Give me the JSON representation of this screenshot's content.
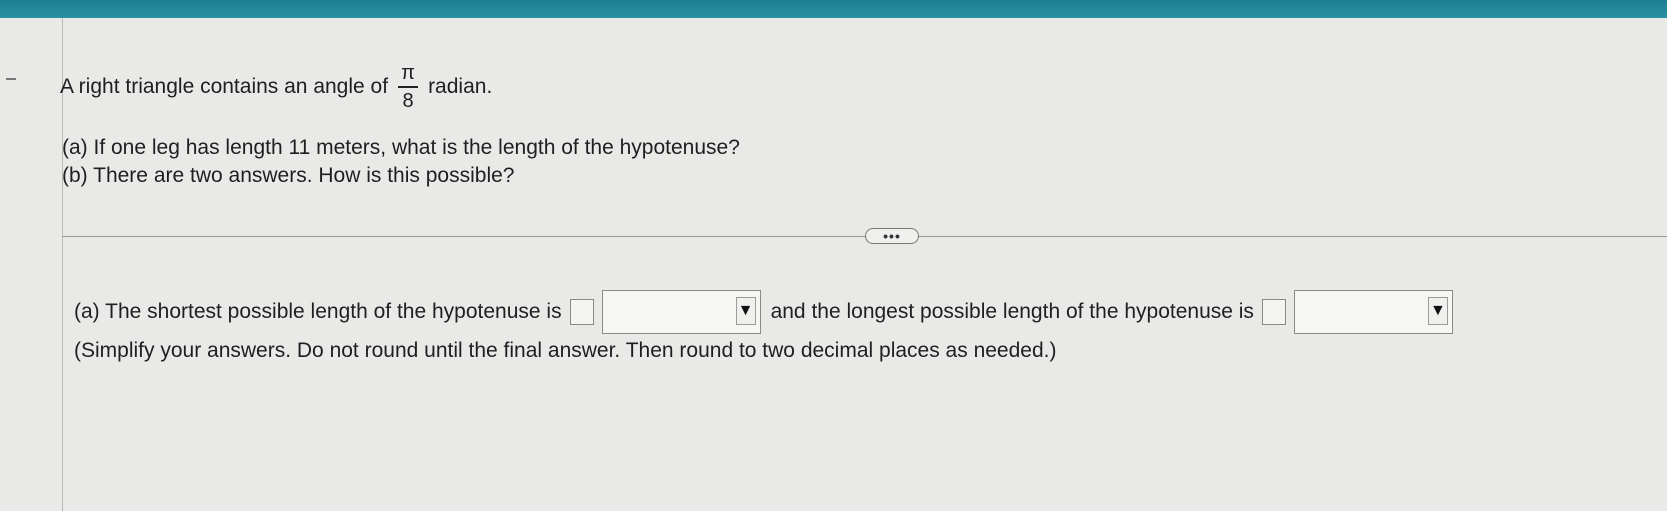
{
  "question": {
    "intro_pre": "A right triangle contains an angle of",
    "fraction_numerator": "π",
    "fraction_denominator": "8",
    "intro_post": "radian.",
    "part_a": "(a) If one leg has length 11 meters, what is the length of the hypotenuse?",
    "part_b": "(b) There are two answers. How is this possible?"
  },
  "more_button_label": "•••",
  "answer": {
    "part_a_pre": "(a) The shortest possible length of the hypotenuse is",
    "part_a_mid": "and the longest possible length of the hypotenuse is",
    "note": "(Simplify your answers. Do not round until the final answer. Then round to two decimal places as needed.)",
    "shortest_value": "",
    "shortest_unit_selected": "",
    "longest_value": "",
    "longest_unit_selected": ""
  },
  "icons": {
    "dropdown": "triangle-down-icon",
    "more": "ellipsis-icon"
  },
  "colors": {
    "top_bar": "#2a8fa3",
    "background": "#e9e9e7"
  }
}
